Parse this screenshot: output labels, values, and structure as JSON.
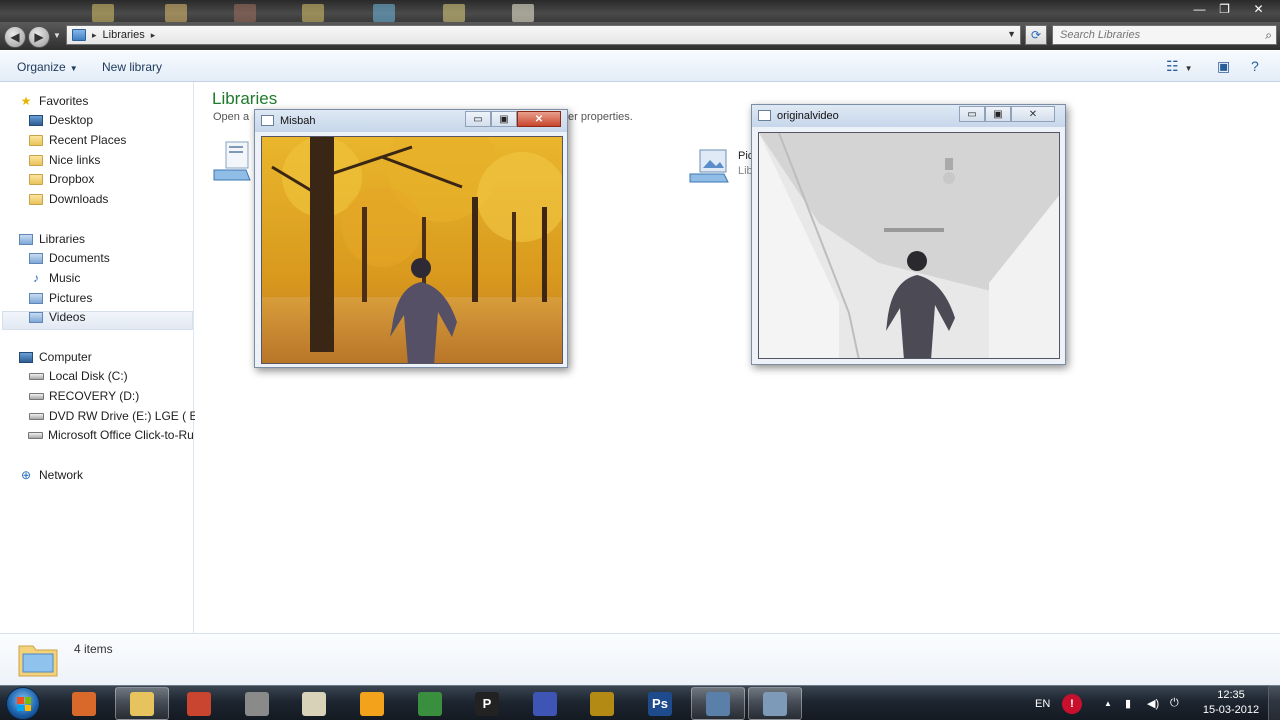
{
  "window": {
    "minimize_glyph": "—",
    "maximize_glyph": "❐",
    "close_glyph": "✕"
  },
  "address": {
    "breadcrumb": "Libraries",
    "separator": "▸",
    "search_placeholder": "Search Libraries"
  },
  "toolbar": {
    "organize_label": "Organize",
    "new_library_label": "New library"
  },
  "nav": {
    "favorites": {
      "label": "Favorites",
      "items": [
        "Desktop",
        "Recent Places",
        "Nice links",
        "Dropbox",
        "Downloads"
      ]
    },
    "libraries": {
      "label": "Libraries",
      "items": [
        "Documents",
        "Music",
        "Pictures",
        "Videos"
      ]
    },
    "computer": {
      "label": "Computer",
      "items": [
        "Local Disk (C:)",
        "RECOVERY (D:)",
        "DVD RW Drive (E:) LGE  ( E : )",
        "Microsoft Office Click-to-Run"
      ]
    },
    "network": {
      "label": "Network"
    }
  },
  "content": {
    "title": "Libraries",
    "description_left": "Open a",
    "description_right": "er properties.",
    "items": [
      {
        "name": "",
        "sub": ""
      },
      {
        "name": "Pic",
        "sub": "Lib"
      }
    ]
  },
  "details": {
    "count_text": "4 items"
  },
  "cv_windows": [
    {
      "title": "Misbah",
      "min": "▭",
      "max": "▣",
      "close": "✕"
    },
    {
      "title": "originalvideo",
      "min": "▭",
      "max": "▣",
      "close": "✕"
    }
  ],
  "taskbar": {
    "apps": [
      {
        "name": "media-player",
        "color": "#d9692a"
      },
      {
        "name": "windows-explorer",
        "color": "#e7c35e"
      },
      {
        "name": "paint",
        "color": "#c9452f"
      },
      {
        "name": "app-gear",
        "color": "#8a8a8a"
      },
      {
        "name": "notepad",
        "color": "#d8d2b8"
      },
      {
        "name": "hand-app",
        "color": "#f2a21b"
      },
      {
        "name": "chrome",
        "color": "#3a8f3e"
      },
      {
        "name": "pandora",
        "color": "#222222",
        "glyph": "P"
      },
      {
        "name": "infinity-app",
        "color": "#3f55b5"
      },
      {
        "name": "disc-app",
        "color": "#b38a14"
      },
      {
        "name": "photoshop",
        "color": "#1d4b8c",
        "glyph": "Ps"
      },
      {
        "name": "video-editor",
        "color": "#5a7fa8"
      },
      {
        "name": "opencv-window",
        "color": "#7d9bb8"
      }
    ],
    "language": "EN",
    "time": "12:35",
    "date": "15-03-2012"
  }
}
